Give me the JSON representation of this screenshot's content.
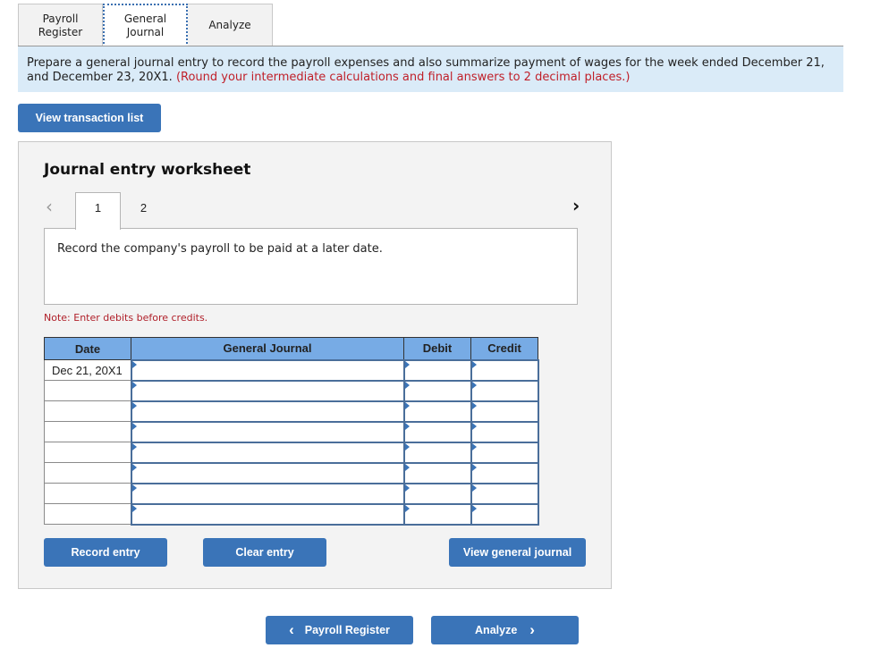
{
  "tabs": [
    {
      "label": "Payroll Register",
      "active": false
    },
    {
      "label": "General Journal",
      "active": true
    },
    {
      "label": "Analyze",
      "active": false
    }
  ],
  "instructions": {
    "text": "Prepare a general journal entry to record the payroll expenses and also summarize payment of wages for the week ended December 21, and December 23, 20X1.",
    "note": "(Round your intermediate calculations and final answers to 2 decimal places.)"
  },
  "buttons": {
    "view_transaction_list": "View transaction list",
    "record_entry": "Record entry",
    "clear_entry": "Clear entry",
    "view_general_journal": "View general journal",
    "prev_page": "Payroll Register",
    "next_page": "Analyze"
  },
  "worksheet": {
    "title": "Journal entry worksheet",
    "steps": [
      "1",
      "2"
    ],
    "active_step": "1",
    "description": "Record the company's payroll to be paid at a later date.",
    "note": "Note: Enter debits before credits.",
    "columns": [
      "Date",
      "General Journal",
      "Debit",
      "Credit"
    ],
    "rows": [
      {
        "date": "Dec 21, 20X1",
        "account": "",
        "debit": "",
        "credit": ""
      },
      {
        "date": "",
        "account": "",
        "debit": "",
        "credit": ""
      },
      {
        "date": "",
        "account": "",
        "debit": "",
        "credit": ""
      },
      {
        "date": "",
        "account": "",
        "debit": "",
        "credit": ""
      },
      {
        "date": "",
        "account": "",
        "debit": "",
        "credit": ""
      },
      {
        "date": "",
        "account": "",
        "debit": "",
        "credit": ""
      },
      {
        "date": "",
        "account": "",
        "debit": "",
        "credit": ""
      },
      {
        "date": "",
        "account": "",
        "debit": "",
        "credit": ""
      }
    ]
  },
  "icons": {
    "prev_step": "‹",
    "next_step": "›",
    "prev_page": "‹",
    "next_page": "›"
  }
}
